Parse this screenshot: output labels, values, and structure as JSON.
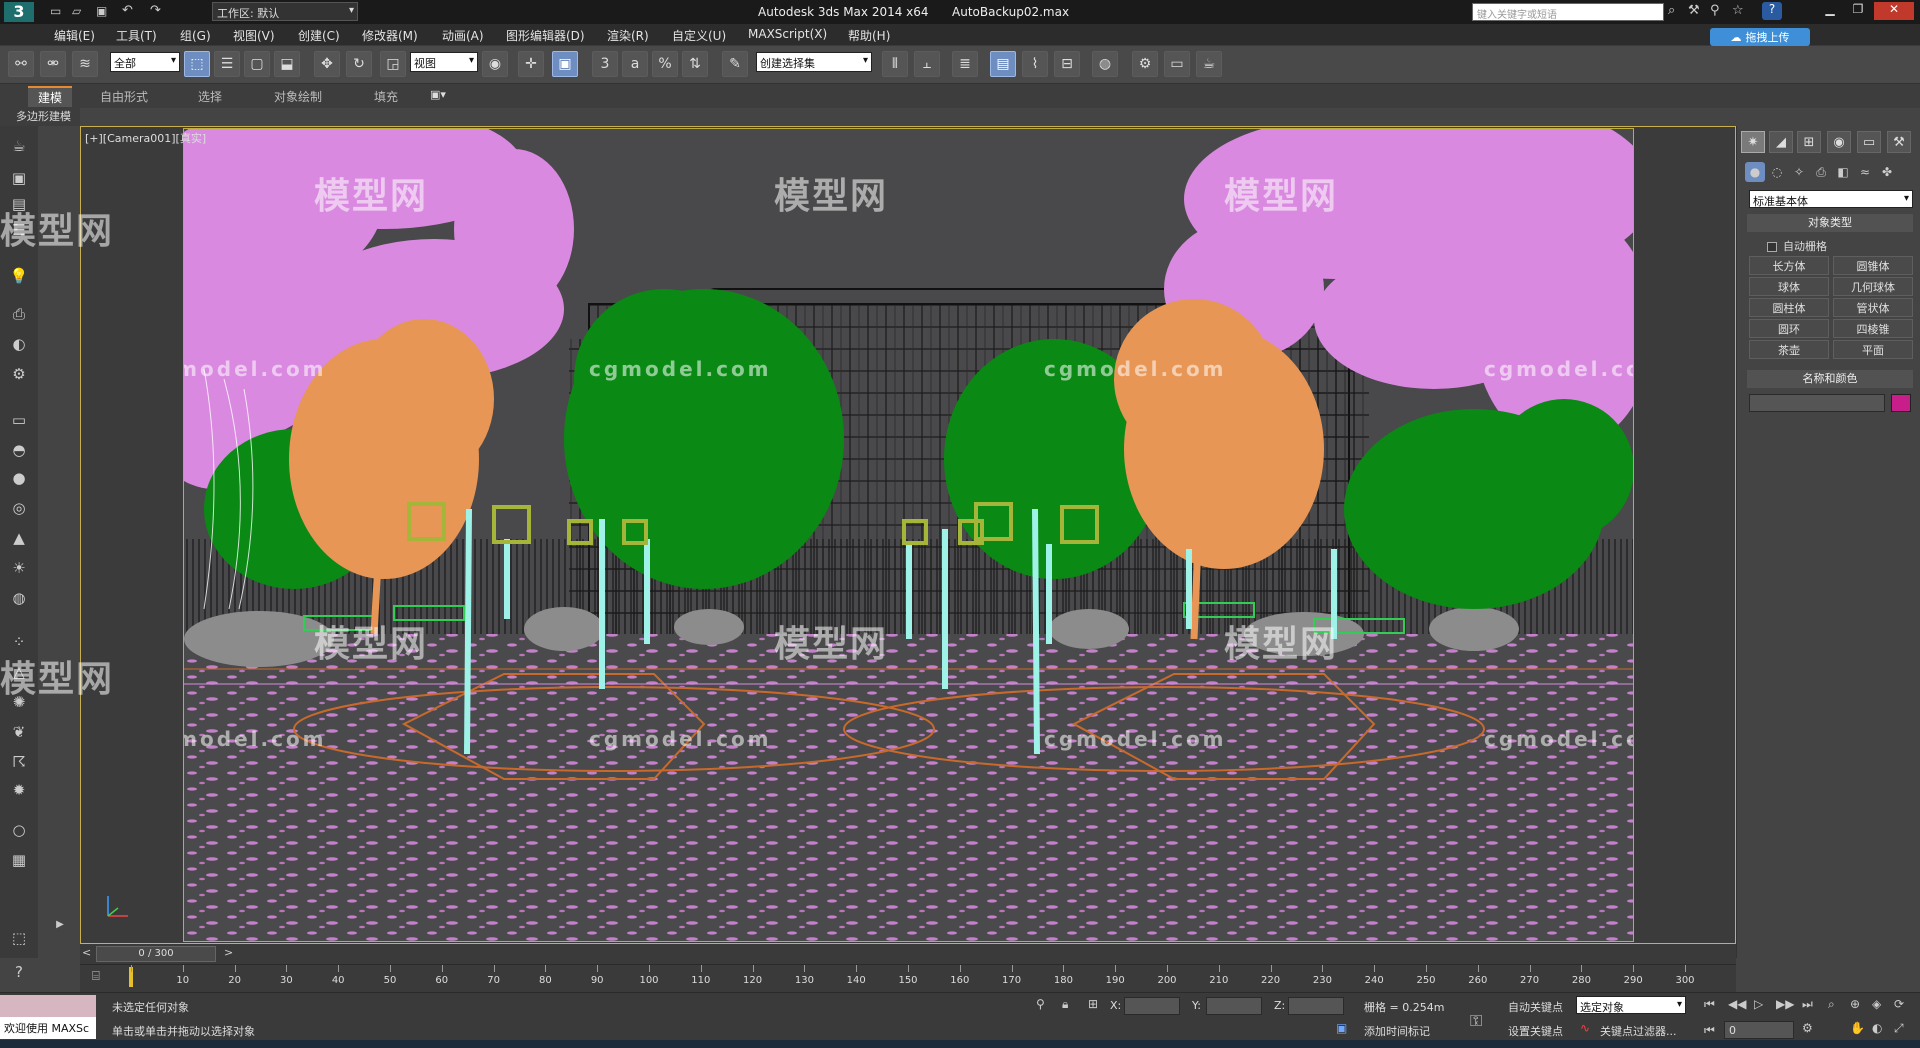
{
  "title_bar": {
    "workspace_label": "工作区: 默认",
    "app_title": "Autodesk 3ds Max  2014 x64",
    "file_name": "AutoBackup02.max",
    "search_placeholder": "键入关键字或短语"
  },
  "menu": [
    "编辑(E)",
    "工具(T)",
    "组(G)",
    "视图(V)",
    "创建(C)",
    "修改器(M)",
    "动画(A)",
    "图形编辑器(D)",
    "渲染(R)",
    "自定义(U)",
    "MAXScript(X)",
    "帮助(H)"
  ],
  "upload_button": "拖拽上传",
  "toolbar": {
    "selection_filter": "全部",
    "reference_coord": "视图",
    "named_selection": "创建选择集",
    "snap_3": "3",
    "snap_angle": "a",
    "snap_percent": "%"
  },
  "ribbon": {
    "tabs": [
      "建模",
      "自由形式",
      "选择",
      "对象绘制",
      "填充"
    ],
    "sub_label": "多边形建模"
  },
  "viewport": {
    "label": "[+][Camera001][真实]",
    "watermark_text": "模型网",
    "watermark_url": "cgmodel.com",
    "colors": {
      "background": "#49484a",
      "pink_tree": "#d98ae0",
      "orange_tree": "#e79655",
      "green_tree": "#0a8a14",
      "pole": "#9ff2e8",
      "lamp": "#a4b53a",
      "building": "#1a1a1a",
      "ground_wire": "#d27a3a"
    }
  },
  "command_panel": {
    "dropdown": "标准基本体",
    "rollout_object_type": "对象类型",
    "autogrid": "自动栅格",
    "buttons": [
      "长方体",
      "圆锥体",
      "球体",
      "几何球体",
      "圆柱体",
      "管状体",
      "圆环",
      "四棱锥",
      "茶壶",
      "平面"
    ],
    "rollout_name_color": "名称和颜色",
    "swatch_color": "#c81e8a"
  },
  "timeline": {
    "frame_counter": "0 / 300",
    "ticks": [
      0,
      10,
      20,
      30,
      40,
      50,
      60,
      70,
      80,
      90,
      100,
      110,
      120,
      130,
      140,
      150,
      160,
      170,
      180,
      190,
      200,
      210,
      220,
      230,
      240,
      250,
      260,
      270,
      280,
      290,
      300
    ]
  },
  "status": {
    "welcome": "欢迎使用 MAXSc",
    "line1": "未选定任何对象",
    "line2": "单击或单击并拖动以选择对象",
    "x_label": "X:",
    "y_label": "Y:",
    "z_label": "Z:",
    "grid": "栅格 = 0.254m",
    "add_time_tag": "添加时间标记",
    "auto_key": "自动关键点",
    "set_key": "设置关键点",
    "selected_object": "选定对象",
    "key_filters": "关键点过滤器...",
    "frame_value": "0"
  }
}
